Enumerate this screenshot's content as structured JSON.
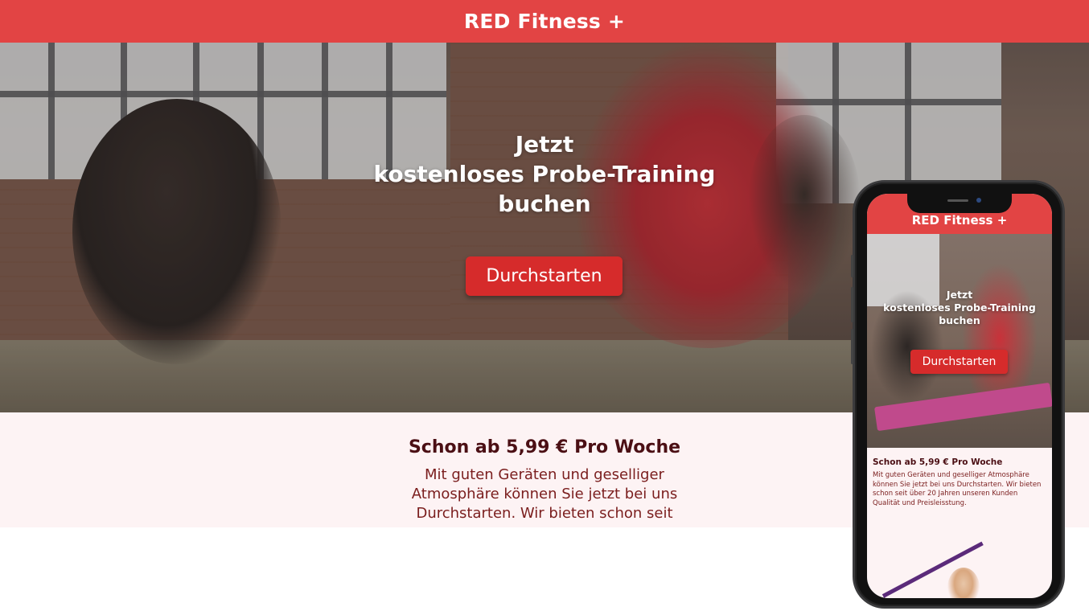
{
  "header": {
    "brand": "RED Fitness +"
  },
  "hero": {
    "line1": "Jetzt",
    "line2": "kostenloses Probe-Training",
    "line3": "buchen",
    "cta_label": "Durchstarten"
  },
  "offer": {
    "title": "Schon ab 5,99 € Pro Woche",
    "text": "Mit guten Geräten und geselliger Atmosphäre können Sie jetzt bei uns Durchstarten. Wir bieten schon seit"
  },
  "mobile": {
    "brand": "RED Fitness +",
    "line1": "Jetzt",
    "line2": "kostenloses Probe-Training",
    "line3": "buchen",
    "cta_label": "Durchstarten",
    "offer_title": "Schon ab 5,99 € Pro Woche",
    "offer_text": "Mit guten Geräten und geselliger Atmosphäre können Sie jetzt bei uns Durchstarten. Wir bieten schon seit über 20 Jahren unseren Kunden Qualität und Preisleisstung."
  },
  "colors": {
    "brand_red": "#e24444",
    "button_red": "#d62b2b",
    "offer_bg": "#fdf3f4",
    "offer_title": "#4b0f14",
    "offer_text": "#7a1d1d"
  }
}
